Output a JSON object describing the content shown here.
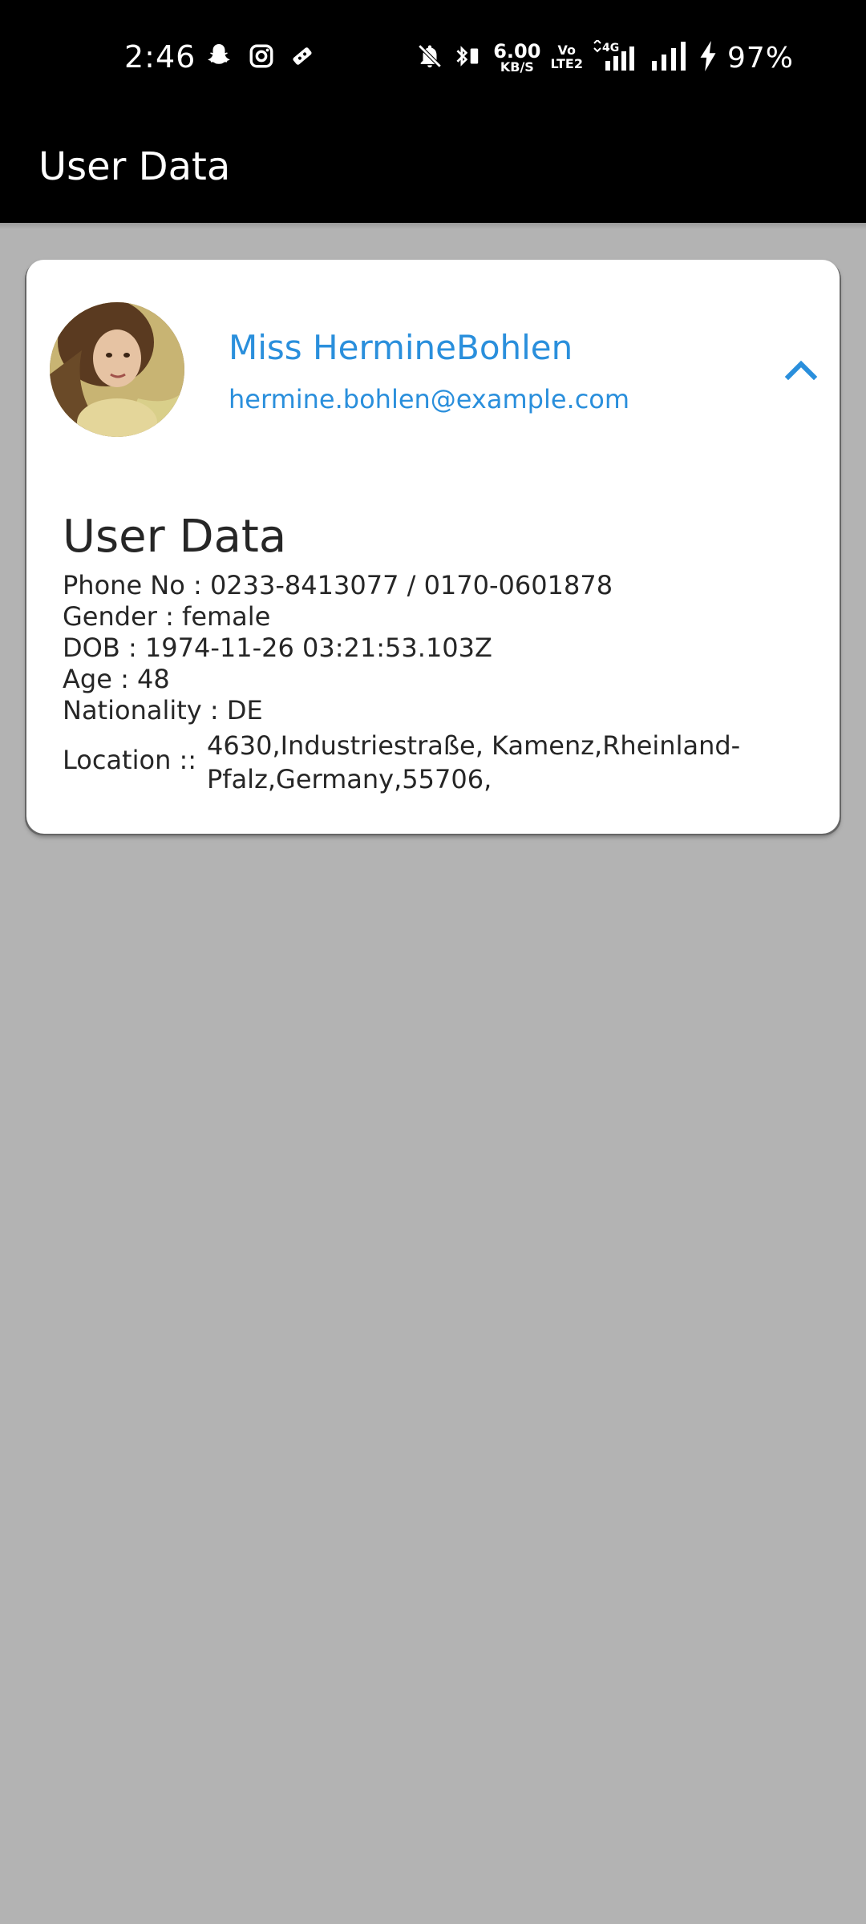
{
  "status_bar": {
    "time": "2:46",
    "left_icons": [
      "snapchat-icon",
      "instagram-icon",
      "video-call-icon"
    ],
    "speed_value": "6.00",
    "speed_unit": "KB/S",
    "volte_top": "Vo",
    "volte_bottom": "LTE2",
    "network": "4G",
    "battery": "97%"
  },
  "app_bar": {
    "title": "User Data"
  },
  "user": {
    "name": "Miss HermineBohlen",
    "email": "hermine.bohlen@example.com"
  },
  "details": {
    "section_title": "User Data",
    "phone": "Phone No : 0233-8413077 / 0170-0601878",
    "gender": "Gender : female",
    "dob": "DOB : 1974-11-26 03:21:53.103Z",
    "age": "Age : 48",
    "nationality": "Nationality : DE",
    "location_label": "Location ::",
    "location_value": "4630,Industriestraße, Kamenz,Rheinland-Pfalz,Germany,55706,"
  },
  "colors": {
    "accent": "#2a8fdc",
    "background": "#b3b3b3",
    "app_bar": "#000000",
    "card": "#ffffff"
  }
}
